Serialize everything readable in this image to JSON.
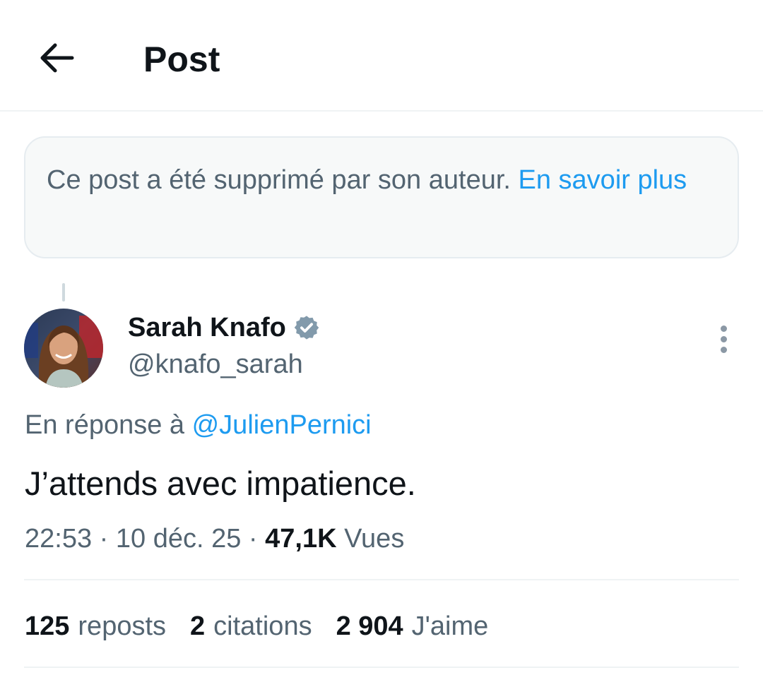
{
  "header": {
    "title": "Post",
    "back_icon": "arrow-left-icon"
  },
  "deleted_notice": {
    "text": "Ce post a été supprimé par son auteur. ",
    "link": "En savoir plus"
  },
  "post": {
    "author": {
      "name": "Sarah Knafo",
      "handle": "@knafo_sarah",
      "verified": true,
      "verified_color": "#829aab"
    },
    "reply_prefix": "En réponse à ",
    "reply_mention": "@JulienPernici",
    "text": "J’attends avec impatience.",
    "time": "22:53",
    "separator": " · ",
    "date": "10 déc. 25",
    "views_count": "47,1K",
    "views_label": "Vues"
  },
  "stats": [
    {
      "count": "125",
      "label": "reposts"
    },
    {
      "count": "2",
      "label": "citations"
    },
    {
      "count": "2 904",
      "label": "J'aime"
    }
  ],
  "colors": {
    "accent": "#1d9bf0",
    "secondary_text": "#536471",
    "primary_text": "#0f1419"
  }
}
